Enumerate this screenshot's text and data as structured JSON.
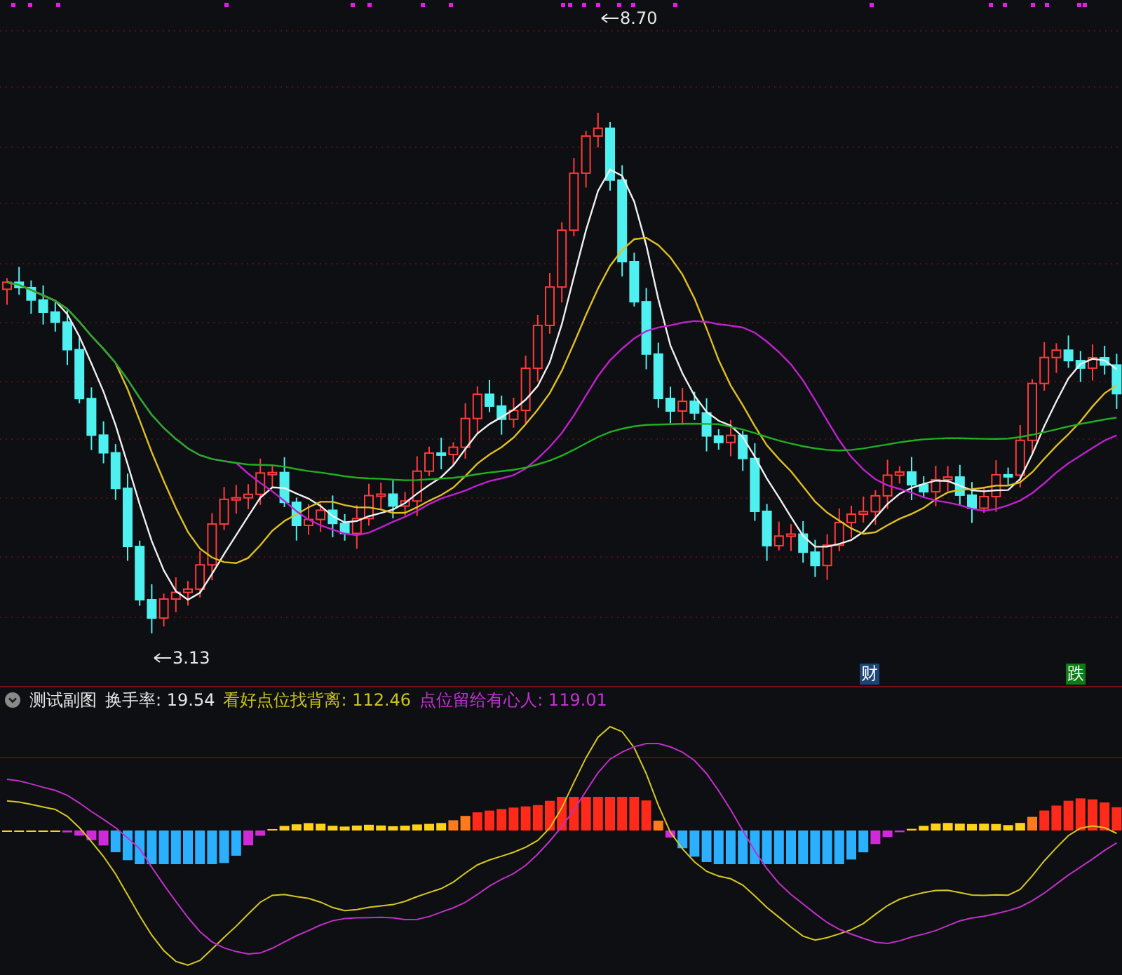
{
  "main_chart": {
    "high_label": "8.70",
    "low_label": "3.13",
    "markers": [
      {
        "text": "财",
        "color": "#1d4477"
      },
      {
        "text": "跌",
        "color": "#0b7d14"
      }
    ]
  },
  "indicator_panel": {
    "title": "测试副图",
    "values": [
      {
        "label": "换手率: 19.54",
        "color": "#e6e6e6"
      },
      {
        "label": "看好点位找背离: 112.46",
        "color": "#c9c21a"
      },
      {
        "label": "点位留给有心人: 119.01",
        "color": "#c431d6"
      }
    ]
  }
}
